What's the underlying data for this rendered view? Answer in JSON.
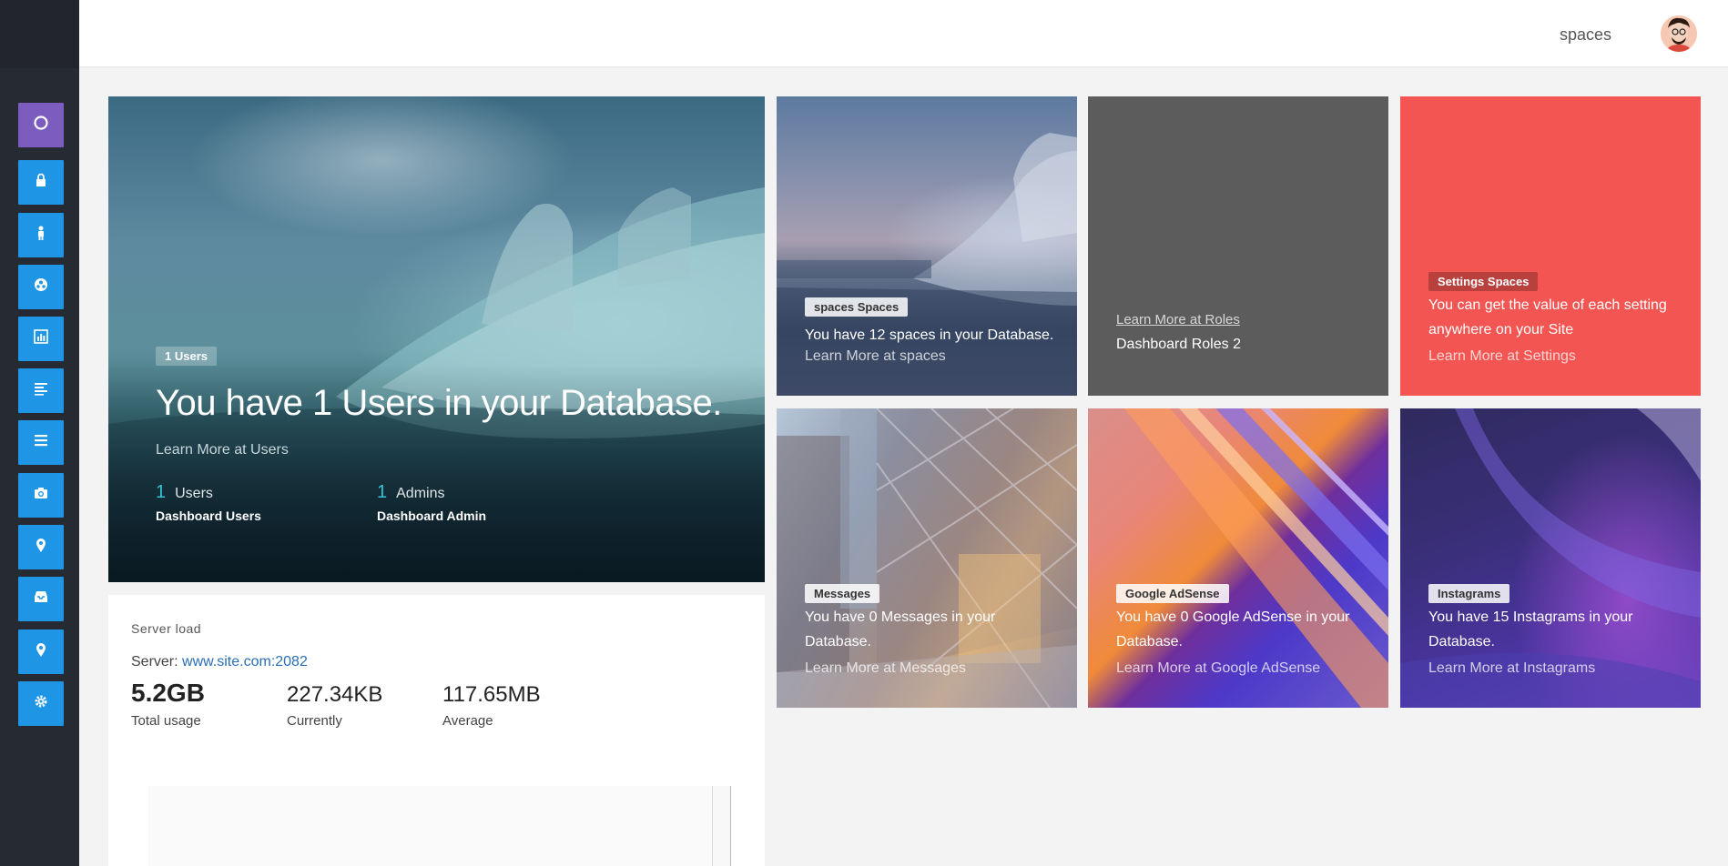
{
  "sidebar": {
    "items": [
      {
        "icon": "circle-icon"
      },
      {
        "icon": "lock-icon"
      },
      {
        "icon": "user-icon"
      },
      {
        "icon": "globe-icon"
      },
      {
        "icon": "chart-icon"
      },
      {
        "icon": "list-icon"
      },
      {
        "icon": "menu-icon"
      },
      {
        "icon": "camera-icon"
      },
      {
        "icon": "map-pin-icon"
      },
      {
        "icon": "inbox-icon"
      },
      {
        "icon": "location-icon"
      },
      {
        "icon": "gear-icon"
      }
    ],
    "colors": {
      "primary": "#1f95e5",
      "active": "#7c5cbf",
      "background": "#262a33"
    }
  },
  "topbar": {
    "user_label": "spaces"
  },
  "hero": {
    "badge": "1 Users",
    "title": "You have 1 Users in your Database.",
    "link": "Learn More at Users",
    "stats": [
      {
        "num": "1",
        "label": "Users",
        "sub": "Dashboard Users"
      },
      {
        "num": "1",
        "label": "Admins",
        "sub": "Dashboard Admin"
      }
    ]
  },
  "server": {
    "title": "Server load",
    "server_prefix": "Server: ",
    "host": "www.site.com:2082",
    "metrics": [
      {
        "value": "5.2GB",
        "caption": "Total usage"
      },
      {
        "value": "227.34KB",
        "caption": "Currently"
      },
      {
        "value": "117.65MB",
        "caption": "Average"
      }
    ]
  },
  "tiles": {
    "spaces": {
      "badge": "spaces Spaces",
      "text": "You have 12 spaces in your Database.",
      "link": "Learn More at spaces"
    },
    "roles": {
      "link": "Learn More at Roles",
      "text": "Dashboard Roles 2"
    },
    "settings": {
      "badge": "Settings Spaces",
      "text": "You can get the value of each setting anywhere on your Site",
      "link": "Learn More at Settings",
      "color": "#f35652"
    },
    "messages": {
      "badge": "Messages",
      "text": "You have 0 Messages in your Database.",
      "link": "Learn More at Messages"
    },
    "adsense": {
      "badge": "Google AdSense",
      "text": "You have 0 Google AdSense in your Database.",
      "link": "Learn More at Google AdSense"
    },
    "instagrams": {
      "badge": "Instagrams",
      "text": "You have 15 Instagrams in your Database.",
      "link": "Learn More at Instagrams"
    }
  }
}
